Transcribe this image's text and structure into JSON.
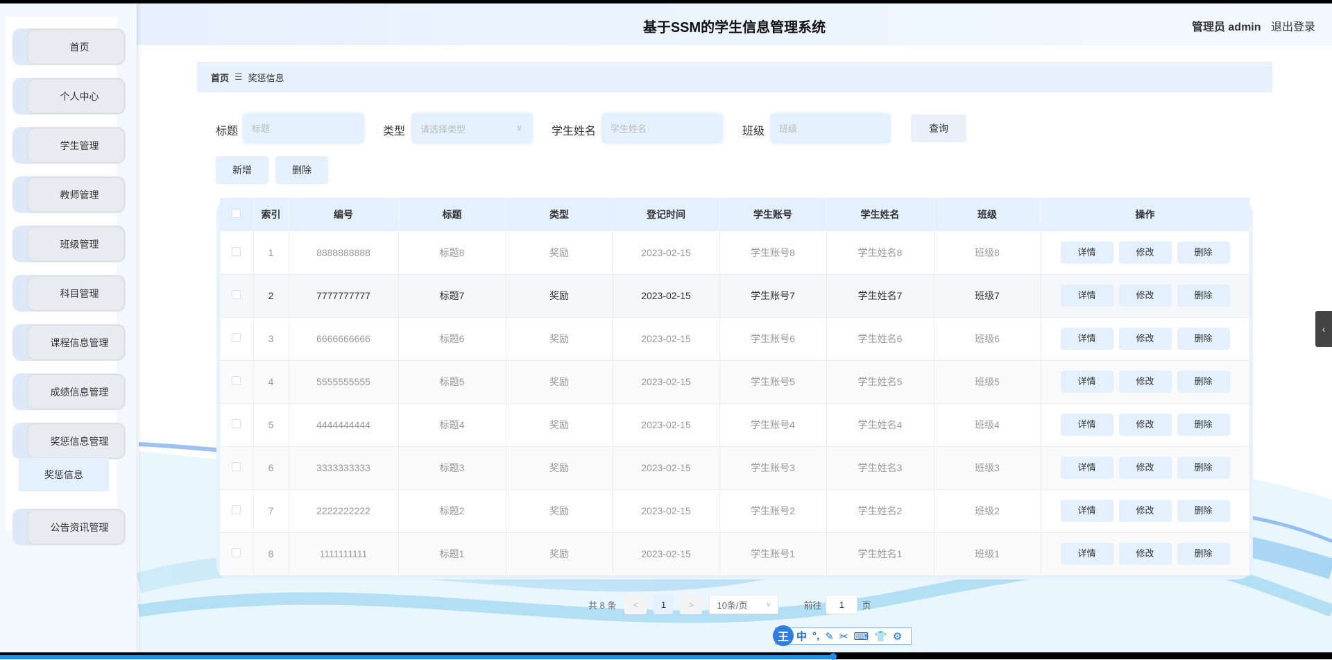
{
  "header": {
    "title": "基于SSM的学生信息管理系统",
    "user": "管理员 admin",
    "logout": "退出登录"
  },
  "sidebar": {
    "items": [
      {
        "label": "首页"
      },
      {
        "label": "个人中心"
      },
      {
        "label": "学生管理"
      },
      {
        "label": "教师管理"
      },
      {
        "label": "班级管理"
      },
      {
        "label": "科目管理"
      },
      {
        "label": "课程信息管理"
      },
      {
        "label": "成绩信息管理"
      },
      {
        "label": "奖惩信息管理"
      },
      {
        "label": "公告资讯管理"
      }
    ],
    "submenu": "奖惩信息"
  },
  "breadcrumb": {
    "home": "首页",
    "sep": "☰",
    "current": "奖惩信息"
  },
  "search": {
    "title_label": "标题",
    "title_placeholder": "标题",
    "type_label": "类型",
    "type_placeholder": "请选择类型",
    "name_label": "学生姓名",
    "name_placeholder": "学生姓名",
    "class_label": "班级",
    "class_placeholder": "班级",
    "query": "查询"
  },
  "actions": {
    "add": "新增",
    "delete": "删除"
  },
  "table": {
    "headers": [
      "索引",
      "编号",
      "标题",
      "类型",
      "登记时间",
      "学生账号",
      "学生姓名",
      "班级",
      "操作"
    ],
    "rows": [
      {
        "idx": "1",
        "no": "8888888888",
        "title": "标题8",
        "type": "奖励",
        "date": "2023-02-15",
        "account": "学生账号8",
        "name": "学生姓名8",
        "cls": "班级8"
      },
      {
        "idx": "2",
        "no": "7777777777",
        "title": "标题7",
        "type": "奖励",
        "date": "2023-02-15",
        "account": "学生账号7",
        "name": "学生姓名7",
        "cls": "班级7"
      },
      {
        "idx": "3",
        "no": "6666666666",
        "title": "标题6",
        "type": "奖励",
        "date": "2023-02-15",
        "account": "学生账号6",
        "name": "学生姓名6",
        "cls": "班级6"
      },
      {
        "idx": "4",
        "no": "5555555555",
        "title": "标题5",
        "type": "奖励",
        "date": "2023-02-15",
        "account": "学生账号5",
        "name": "学生姓名5",
        "cls": "班级5"
      },
      {
        "idx": "5",
        "no": "4444444444",
        "title": "标题4",
        "type": "奖励",
        "date": "2023-02-15",
        "account": "学生账号4",
        "name": "学生姓名4",
        "cls": "班级4"
      },
      {
        "idx": "6",
        "no": "3333333333",
        "title": "标题3",
        "type": "奖励",
        "date": "2023-02-15",
        "account": "学生账号3",
        "name": "学生姓名3",
        "cls": "班级3"
      },
      {
        "idx": "7",
        "no": "2222222222",
        "title": "标题2",
        "type": "奖励",
        "date": "2023-02-15",
        "account": "学生账号2",
        "name": "学生姓名2",
        "cls": "班级2"
      },
      {
        "idx": "8",
        "no": "1111111111",
        "title": "标题1",
        "type": "奖励",
        "date": "2023-02-15",
        "account": "学生账号1",
        "name": "学生姓名1",
        "cls": "班级1"
      }
    ],
    "ops": {
      "detail": "详情",
      "edit": "修改",
      "delete": "删除"
    }
  },
  "pagination": {
    "total": "共 8 条",
    "prev": "<",
    "page": "1",
    "next": ">",
    "size": "10条/页",
    "goto": "前往",
    "goto_value": "1",
    "page_unit": "页"
  },
  "ime": {
    "logo": "王",
    "lang": "中",
    "punct": "°,",
    "pen": "✎",
    "cut": "✂",
    "keyboard": "⌨",
    "skin": "👕",
    "settings": "⚙"
  },
  "edge_tab": "‹"
}
